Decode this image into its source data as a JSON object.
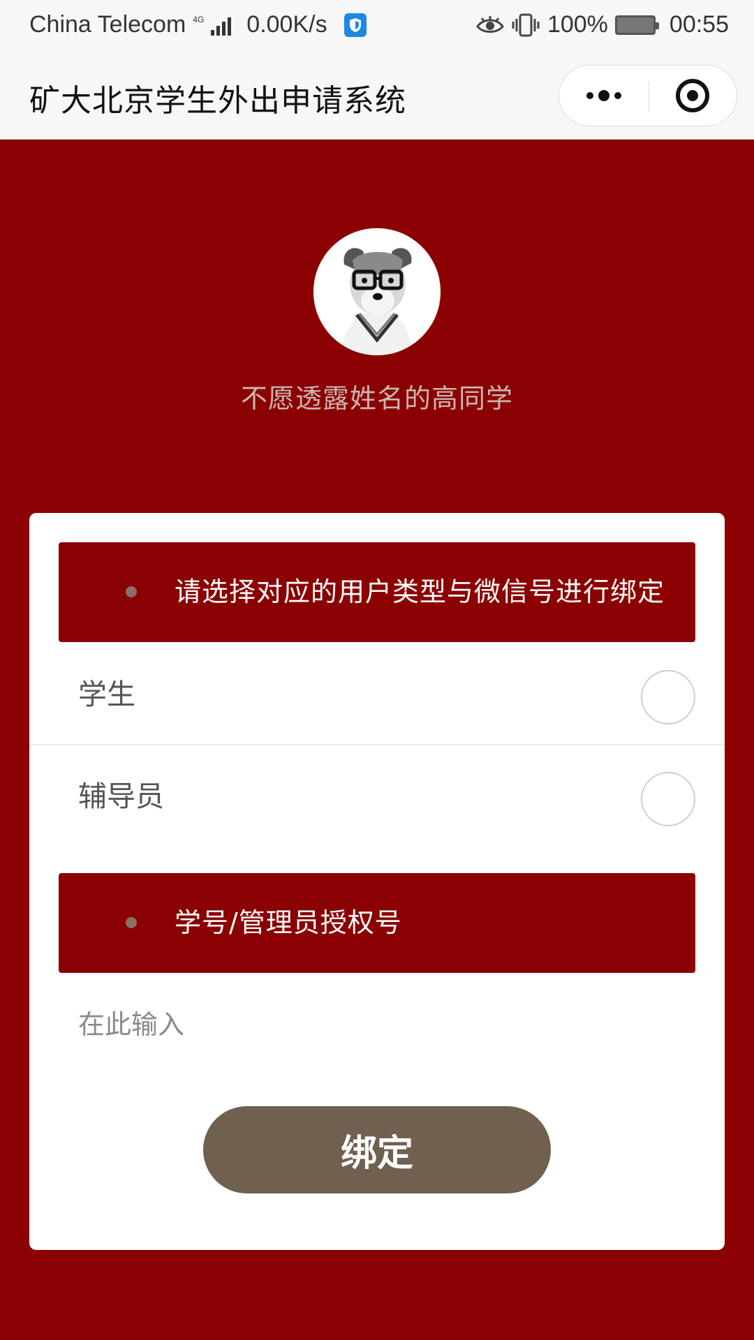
{
  "status_bar": {
    "carrier": "China Telecom",
    "network": "4G",
    "speed": "0.00K/s",
    "battery": "100%",
    "time": "00:55",
    "icons": [
      "signal-icon",
      "shield-icon",
      "eye-icon",
      "vibrate-icon",
      "battery-icon"
    ]
  },
  "title_bar": {
    "title": "矿大北京学生外出申请系统",
    "icons": [
      "more-icon",
      "target-icon"
    ]
  },
  "profile": {
    "avatar_icon": "dog-with-glasses-avatar",
    "name": "不愿透露姓名的高同学"
  },
  "card": {
    "user_type_header": "请选择对应的用户类型与微信号进行绑定",
    "options": [
      {
        "label": "学生",
        "selected": false
      },
      {
        "label": "辅导员",
        "selected": false
      }
    ],
    "id_header": "学号/管理员授权号",
    "id_input": {
      "value": "",
      "placeholder": "在此输入"
    },
    "bind_button": "绑定"
  },
  "colors": {
    "background": "#8b0000",
    "header_band": "#8b0000",
    "button": "#6f6050",
    "bullet": "#8c6e66"
  }
}
